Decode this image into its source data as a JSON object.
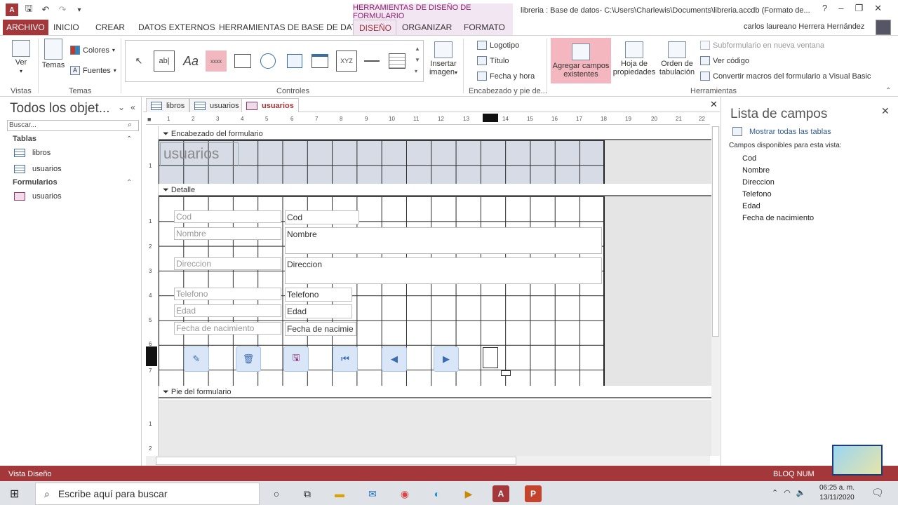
{
  "title_bar": {
    "context_tab": "HERRAMIENTAS DE DISEÑO DE FORMULARIO",
    "window_title": "libreria : Base de datos- C:\\Users\\Charlewis\\Documents\\libreria.accdb (Formato de...",
    "help": "?",
    "minimize": "–",
    "restore": "❐",
    "close": "✕"
  },
  "ribbon_tabs": {
    "archivo": "ARCHIVO",
    "inicio": "INICIO",
    "crear": "CREAR",
    "datos_externos": "DATOS EXTERNOS",
    "herramientas_bd": "HERRAMIENTAS DE BASE DE DATOS",
    "diseno": "DISEÑO",
    "organizar": "ORGANIZAR",
    "formato": "FORMATO"
  },
  "user": {
    "name": "carlos laureano Herrera Hernández"
  },
  "ribbon": {
    "ver": "Ver",
    "temas": "Temas",
    "colores": "Colores",
    "fuentes": "Fuentes",
    "vistas_label": "Vistas",
    "temas_label": "Temas",
    "controles_label": "Controles",
    "insertar_imagen_1": "Insertar",
    "insertar_imagen_2": "imagen",
    "logotipo": "Logotipo",
    "titulo": "Título",
    "fecha_hora": "Fecha y hora",
    "encabezado_label": "Encabezado y pie de...",
    "agregar_campos_1": "Agregar campos",
    "agregar_campos_2": "existentes",
    "hoja_prop_1": "Hoja de",
    "hoja_prop_2": "propiedades",
    "orden_tab_1": "Orden de",
    "orden_tab_2": "tabulación",
    "subformulario": "Subformulario en nueva ventana",
    "ver_codigo": "Ver código",
    "convertir_macros": "Convertir macros del formulario a Visual Basic",
    "herramientas_label": "Herramientas",
    "gallery": {
      "select": "↖",
      "textbox": "ab|",
      "label": "Aa",
      "button": "xxxx",
      "tab": "",
      "hyperlink": "",
      "web": "",
      "nav": "",
      "xyz": "XYZ",
      "line": "",
      "list": ""
    }
  },
  "nav_pane": {
    "title": "Todos los objet...",
    "search_placeholder": "Buscar...",
    "tables_head": "Tablas",
    "tables": [
      "libros",
      "usuarios"
    ],
    "forms_head": "Formularios",
    "forms": [
      "usuarios"
    ]
  },
  "doc_tabs": [
    "libros",
    "usuarios",
    "usuarios"
  ],
  "ruler": {
    "numbers": [
      "1",
      "2",
      "3",
      "4",
      "5",
      "6",
      "7",
      "8",
      "9",
      "10",
      "11",
      "12",
      "13",
      "14",
      "15",
      "16",
      "17",
      "18",
      "19",
      "20",
      "21",
      "22"
    ],
    "vnumbers_header": [
      "1"
    ],
    "vnumbers_detail": [
      "1",
      "2",
      "3",
      "4",
      "5",
      "6",
      "7"
    ],
    "vnumbers_footer": [
      "1",
      "2"
    ]
  },
  "design": {
    "section_header": "Encabezado del formulario",
    "section_detail": "Detalle",
    "section_footer": "Pie del formulario",
    "form_title": "usuarios",
    "fields": [
      {
        "label": "Cod",
        "value": "Cod"
      },
      {
        "label": "Nombre",
        "value": "Nombre"
      },
      {
        "label": "Direccion",
        "value": "Direccion"
      },
      {
        "label": "Telefono",
        "value": "Telefono"
      },
      {
        "label": "Edad",
        "value": "Edad"
      },
      {
        "label": "Fecha de nacimiento",
        "value": "Fecha de nacimie"
      }
    ]
  },
  "field_list": {
    "title": "Lista de campos",
    "show_all": "Mostrar todas las tablas",
    "available": "Campos disponibles para esta vista:",
    "fields": [
      "Cod",
      "Nombre",
      "Direccion",
      "Telefono",
      "Edad",
      "Fecha de nacimiento"
    ]
  },
  "status_bar": {
    "view": "Vista Diseño",
    "num_lock": "BLOQ NUM"
  },
  "taskbar": {
    "search_placeholder": "Escribe aquí para buscar",
    "time": "06:25 a. m.",
    "date": "13/11/2020"
  },
  "colors": {
    "access_red": "#a4373a",
    "context_purple": "#8a1f6b",
    "selected_pink": "#f4b6bf",
    "header_section": "#d6dbe5"
  }
}
